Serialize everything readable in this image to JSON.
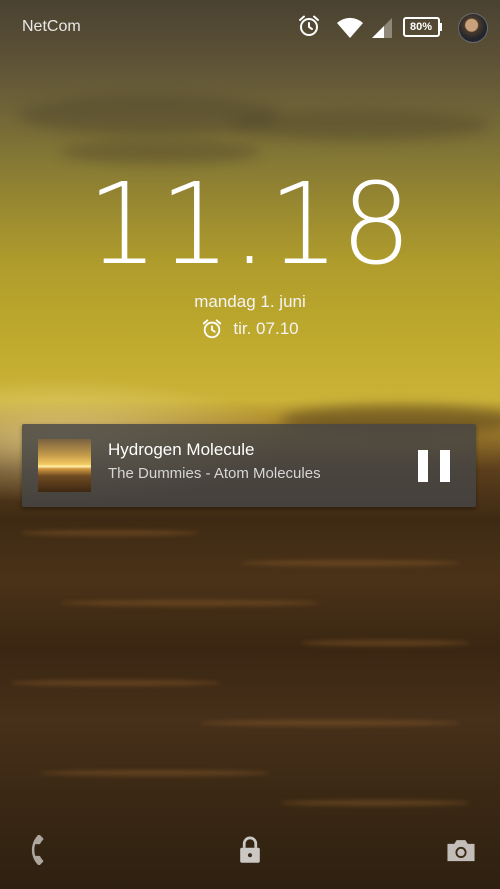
{
  "status_bar": {
    "carrier": "NetCom",
    "battery_percent": "80%",
    "icons": [
      "alarm-icon",
      "wifi-icon",
      "cell-signal-icon",
      "battery-icon",
      "avatar"
    ]
  },
  "lockscreen": {
    "time": "11.18",
    "date": "mandag 1. juni",
    "next_alarm": "tir. 07.10"
  },
  "media": {
    "title": "Hydrogen Molecule",
    "subtitle": "The Dummies - Atom Molecules",
    "control": "pause-icon"
  },
  "bottom_bar": {
    "icons": [
      "phone-icon",
      "lock-icon",
      "camera-icon"
    ]
  },
  "colors": {
    "text": "#ffffff",
    "card_bg": "#464646"
  }
}
